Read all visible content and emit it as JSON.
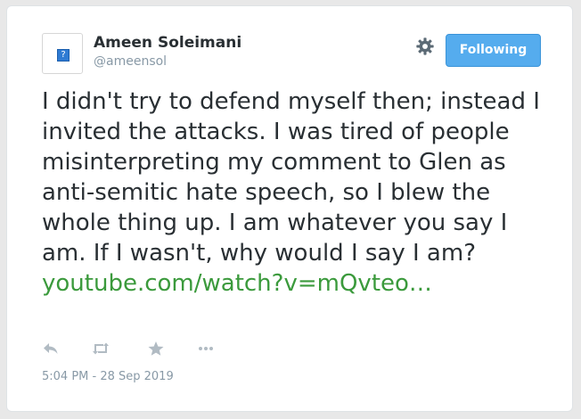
{
  "user": {
    "display_name": "Ameen Soleimani",
    "handle": "@ameensol",
    "avatar_placeholder": "?"
  },
  "header": {
    "follow_button_label": "Following"
  },
  "tweet": {
    "text": "I didn't try to defend myself then; instead I invited the attacks. I was tired of people misinterpreting my comment to Glen as anti-semitic hate speech, so I blew the whole thing up. I am whatever you say I am. If I wasn't, why would I say I am?",
    "link_text": "youtube.com/watch?v=mQvteo…",
    "timestamp": "5:04 PM - 28 Sep 2019"
  },
  "actions": [
    {
      "icon": "reply-icon"
    },
    {
      "icon": "retweet-icon"
    },
    {
      "icon": "like-icon"
    },
    {
      "icon": "more-icon"
    }
  ],
  "colors": {
    "accent": "#55acee",
    "link": "#3b9a3c",
    "text": "#292f33",
    "muted": "#8899a6"
  }
}
